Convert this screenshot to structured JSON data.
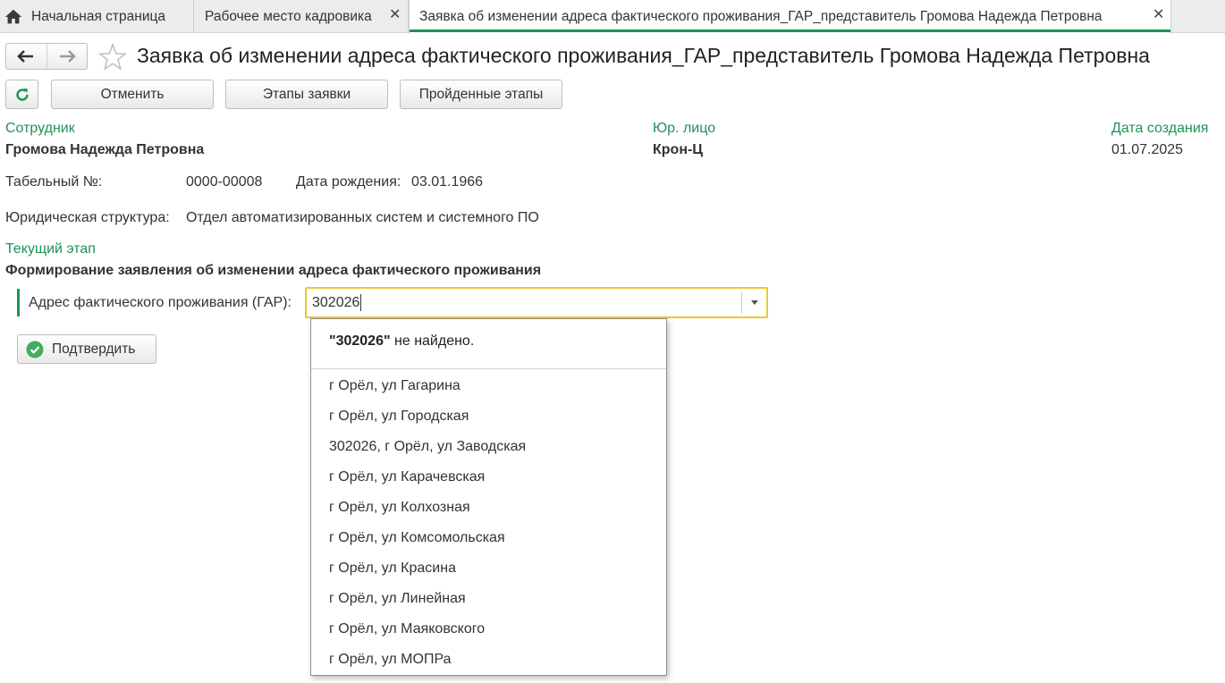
{
  "tabs": {
    "home": "Начальная страница",
    "hr_workplace": "Рабочее место кадровика",
    "request": "Заявка об изменении адреса фактического проживания_ГАР_представитель Громова Надежда Петровна"
  },
  "title": "Заявка об изменении адреса фактического проживания_ГАР_представитель Громова Надежда Петровна",
  "toolbar": {
    "cancel": "Отменить",
    "stages": "Этапы заявки",
    "passed_stages": "Пройденные этапы"
  },
  "employee": {
    "label": "Сотрудник",
    "value": "Громова Надежда Петровна"
  },
  "legal_entity": {
    "label": "Юр. лицо",
    "value": "Крон-Ц"
  },
  "created": {
    "label": "Дата создания",
    "value": "01.07.2025"
  },
  "tab_number": {
    "label": "Табельный №:",
    "value": "0000-00008"
  },
  "birth_date": {
    "label": "Дата рождения:",
    "value": "03.01.1966"
  },
  "structure": {
    "label": "Юридическая структура:",
    "value": "Отдел автоматизированных систем и системного ПО"
  },
  "current_stage": {
    "label": "Текущий этап",
    "value": "Формирование заявления об изменении адреса фактического проживания"
  },
  "address": {
    "label": "Адрес фактического проживания (ГАР):",
    "value": "302026"
  },
  "confirm": "Подтвердить",
  "dropdown": {
    "query": "\"302026\"",
    "not_found": " не найдено.",
    "items": [
      "г Орёл, ул Гагарина",
      "г Орёл, ул Городская",
      "302026, г Орёл, ул Заводская",
      "г Орёл, ул Карачевская",
      "г Орёл, ул Колхозная",
      "г Орёл, ул Комсомольская",
      "г Орёл, ул Красина",
      "г Орёл, ул Линейная",
      "г Орёл, ул Маяковского",
      "г Орёл, ул МОПРа"
    ]
  },
  "colors": {
    "accent": "#1f9257",
    "focus": "#f2c531"
  }
}
